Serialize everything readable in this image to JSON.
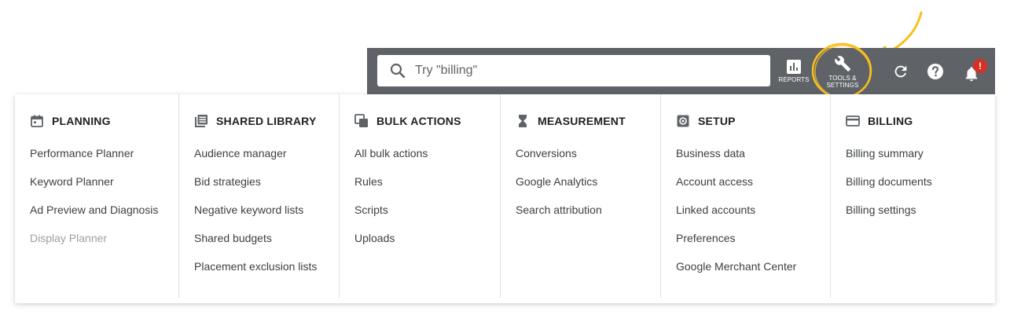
{
  "search": {
    "placeholder": "Try \"billing\""
  },
  "toolbar": {
    "reports_label": "REPORTS",
    "tools_label_line1": "TOOLS &",
    "tools_label_line2": "SETTINGS",
    "notification_badge": "!"
  },
  "colors": {
    "toolbar_bg": "#5f6368",
    "highlight": "#f9bf1e",
    "badge": "#d93025",
    "text": "#3c4043",
    "disabled_text": "#9aa0a6"
  },
  "columns": [
    {
      "title": "PLANNING",
      "icon": "calendar-icon",
      "items": [
        "Performance Planner",
        "Keyword Planner",
        "Ad Preview and Diagnosis",
        "Display Planner"
      ],
      "disabled": [
        "Display Planner"
      ]
    },
    {
      "title": "SHARED LIBRARY",
      "icon": "library-icon",
      "items": [
        "Audience manager",
        "Bid strategies",
        "Negative keyword lists",
        "Shared budgets",
        "Placement exclusion lists"
      ]
    },
    {
      "title": "BULK ACTIONS",
      "icon": "copy-icon",
      "items": [
        "All bulk actions",
        "Rules",
        "Scripts",
        "Uploads"
      ]
    },
    {
      "title": "MEASUREMENT",
      "icon": "hourglass-icon",
      "items": [
        "Conversions",
        "Google Analytics",
        "Search attribution"
      ]
    },
    {
      "title": "SETUP",
      "icon": "settings-box-icon",
      "items": [
        "Business data",
        "Account access",
        "Linked accounts",
        "Preferences",
        "Google Merchant Center"
      ]
    },
    {
      "title": "BILLING",
      "icon": "credit-card-icon",
      "items": [
        "Billing summary",
        "Billing documents",
        "Billing settings"
      ]
    }
  ]
}
